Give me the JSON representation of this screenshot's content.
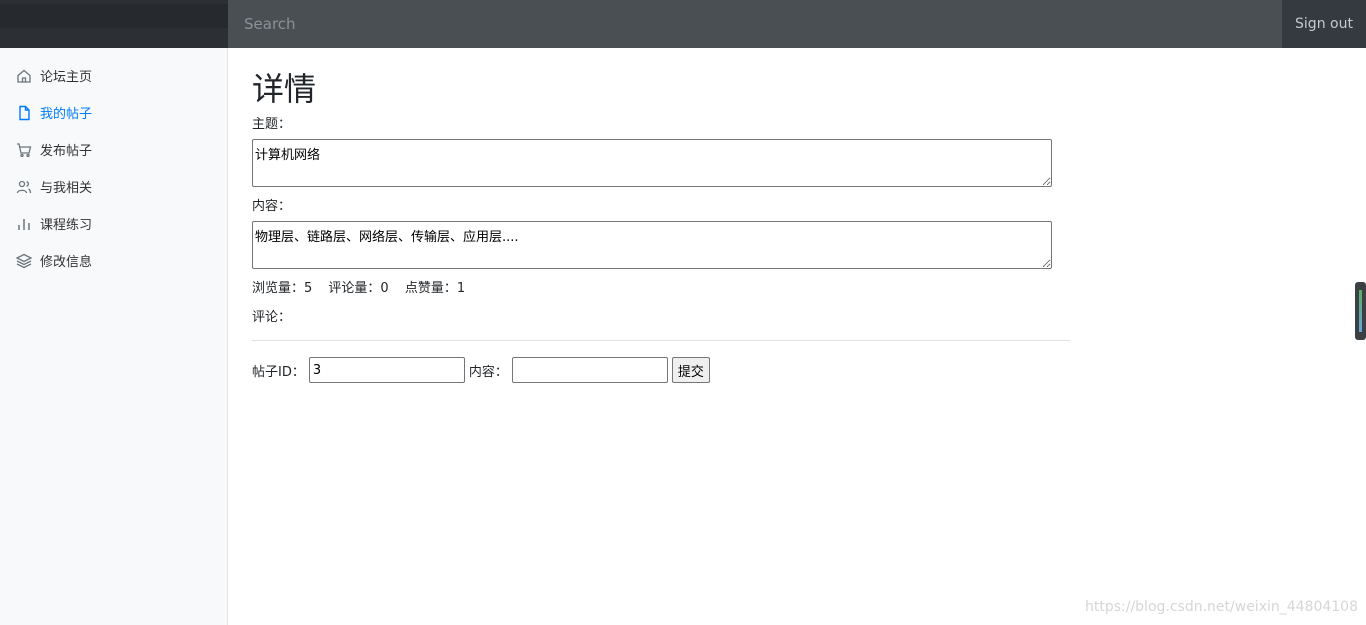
{
  "header": {
    "search_placeholder": "Search",
    "signout_label": "Sign out"
  },
  "sidebar": {
    "items": [
      {
        "label": "论坛主页",
        "icon": "home-icon"
      },
      {
        "label": "我的帖子",
        "icon": "file-icon",
        "active": true
      },
      {
        "label": "发布帖子",
        "icon": "cart-icon"
      },
      {
        "label": "与我相关",
        "icon": "users-icon"
      },
      {
        "label": "课程练习",
        "icon": "bar-chart-icon"
      },
      {
        "label": "修改信息",
        "icon": "layers-icon"
      }
    ]
  },
  "main": {
    "title": "详情",
    "subject_label": "主题：",
    "subject_value": "计算机网络",
    "content_label": "内容：",
    "content_value": "物理层、链路层、网络层、传输层、应用层....",
    "stats": {
      "views": "浏览量：5",
      "comments": "评论量：0",
      "likes": "点赞量：1"
    },
    "comments_label": "评论：",
    "form": {
      "post_id_label": "帖子ID：",
      "post_id_value": "3",
      "content_label": "内容：",
      "content_value": "",
      "submit_label": "提交"
    }
  },
  "watermark": "https://blog.csdn.net/weixin_44804108",
  "colors": {
    "navbar": "#343a40",
    "sidebar": "#f8f9fa",
    "active": "#007bff"
  }
}
